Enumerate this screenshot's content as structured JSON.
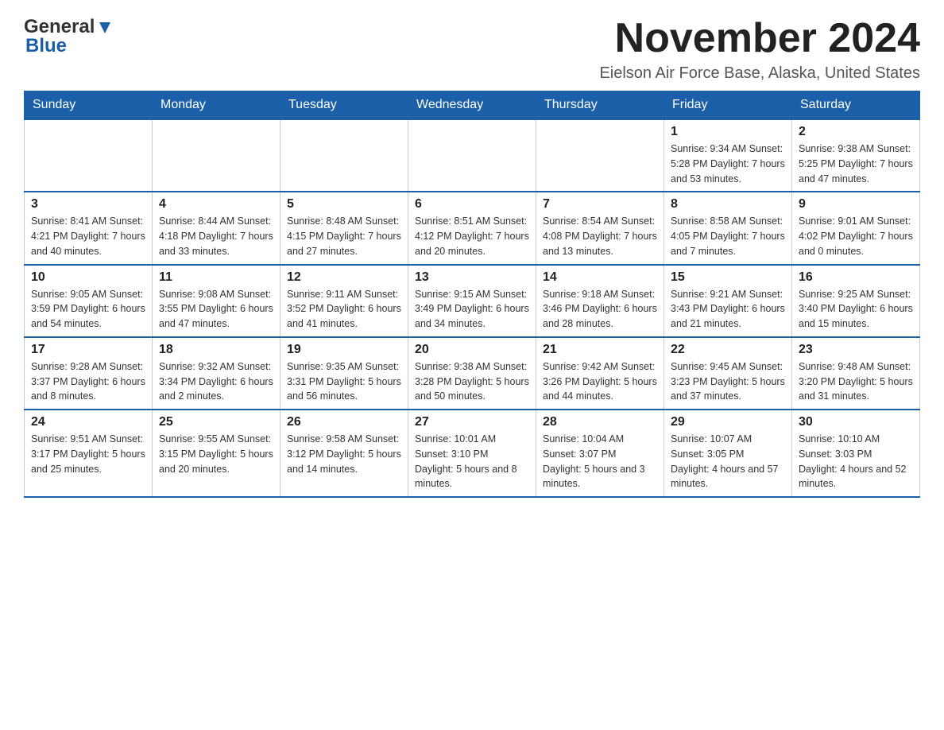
{
  "logo": {
    "general": "General",
    "blue": "Blue"
  },
  "title": "November 2024",
  "subtitle": "Eielson Air Force Base, Alaska, United States",
  "weekdays": [
    "Sunday",
    "Monday",
    "Tuesday",
    "Wednesday",
    "Thursday",
    "Friday",
    "Saturday"
  ],
  "weeks": [
    [
      {
        "day": "",
        "info": ""
      },
      {
        "day": "",
        "info": ""
      },
      {
        "day": "",
        "info": ""
      },
      {
        "day": "",
        "info": ""
      },
      {
        "day": "",
        "info": ""
      },
      {
        "day": "1",
        "info": "Sunrise: 9:34 AM\nSunset: 5:28 PM\nDaylight: 7 hours\nand 53 minutes."
      },
      {
        "day": "2",
        "info": "Sunrise: 9:38 AM\nSunset: 5:25 PM\nDaylight: 7 hours\nand 47 minutes."
      }
    ],
    [
      {
        "day": "3",
        "info": "Sunrise: 8:41 AM\nSunset: 4:21 PM\nDaylight: 7 hours\nand 40 minutes."
      },
      {
        "day": "4",
        "info": "Sunrise: 8:44 AM\nSunset: 4:18 PM\nDaylight: 7 hours\nand 33 minutes."
      },
      {
        "day": "5",
        "info": "Sunrise: 8:48 AM\nSunset: 4:15 PM\nDaylight: 7 hours\nand 27 minutes."
      },
      {
        "day": "6",
        "info": "Sunrise: 8:51 AM\nSunset: 4:12 PM\nDaylight: 7 hours\nand 20 minutes."
      },
      {
        "day": "7",
        "info": "Sunrise: 8:54 AM\nSunset: 4:08 PM\nDaylight: 7 hours\nand 13 minutes."
      },
      {
        "day": "8",
        "info": "Sunrise: 8:58 AM\nSunset: 4:05 PM\nDaylight: 7 hours\nand 7 minutes."
      },
      {
        "day": "9",
        "info": "Sunrise: 9:01 AM\nSunset: 4:02 PM\nDaylight: 7 hours\nand 0 minutes."
      }
    ],
    [
      {
        "day": "10",
        "info": "Sunrise: 9:05 AM\nSunset: 3:59 PM\nDaylight: 6 hours\nand 54 minutes."
      },
      {
        "day": "11",
        "info": "Sunrise: 9:08 AM\nSunset: 3:55 PM\nDaylight: 6 hours\nand 47 minutes."
      },
      {
        "day": "12",
        "info": "Sunrise: 9:11 AM\nSunset: 3:52 PM\nDaylight: 6 hours\nand 41 minutes."
      },
      {
        "day": "13",
        "info": "Sunrise: 9:15 AM\nSunset: 3:49 PM\nDaylight: 6 hours\nand 34 minutes."
      },
      {
        "day": "14",
        "info": "Sunrise: 9:18 AM\nSunset: 3:46 PM\nDaylight: 6 hours\nand 28 minutes."
      },
      {
        "day": "15",
        "info": "Sunrise: 9:21 AM\nSunset: 3:43 PM\nDaylight: 6 hours\nand 21 minutes."
      },
      {
        "day": "16",
        "info": "Sunrise: 9:25 AM\nSunset: 3:40 PM\nDaylight: 6 hours\nand 15 minutes."
      }
    ],
    [
      {
        "day": "17",
        "info": "Sunrise: 9:28 AM\nSunset: 3:37 PM\nDaylight: 6 hours\nand 8 minutes."
      },
      {
        "day": "18",
        "info": "Sunrise: 9:32 AM\nSunset: 3:34 PM\nDaylight: 6 hours\nand 2 minutes."
      },
      {
        "day": "19",
        "info": "Sunrise: 9:35 AM\nSunset: 3:31 PM\nDaylight: 5 hours\nand 56 minutes."
      },
      {
        "day": "20",
        "info": "Sunrise: 9:38 AM\nSunset: 3:28 PM\nDaylight: 5 hours\nand 50 minutes."
      },
      {
        "day": "21",
        "info": "Sunrise: 9:42 AM\nSunset: 3:26 PM\nDaylight: 5 hours\nand 44 minutes."
      },
      {
        "day": "22",
        "info": "Sunrise: 9:45 AM\nSunset: 3:23 PM\nDaylight: 5 hours\nand 37 minutes."
      },
      {
        "day": "23",
        "info": "Sunrise: 9:48 AM\nSunset: 3:20 PM\nDaylight: 5 hours\nand 31 minutes."
      }
    ],
    [
      {
        "day": "24",
        "info": "Sunrise: 9:51 AM\nSunset: 3:17 PM\nDaylight: 5 hours\nand 25 minutes."
      },
      {
        "day": "25",
        "info": "Sunrise: 9:55 AM\nSunset: 3:15 PM\nDaylight: 5 hours\nand 20 minutes."
      },
      {
        "day": "26",
        "info": "Sunrise: 9:58 AM\nSunset: 3:12 PM\nDaylight: 5 hours\nand 14 minutes."
      },
      {
        "day": "27",
        "info": "Sunrise: 10:01 AM\nSunset: 3:10 PM\nDaylight: 5 hours\nand 8 minutes."
      },
      {
        "day": "28",
        "info": "Sunrise: 10:04 AM\nSunset: 3:07 PM\nDaylight: 5 hours\nand 3 minutes."
      },
      {
        "day": "29",
        "info": "Sunrise: 10:07 AM\nSunset: 3:05 PM\nDaylight: 4 hours\nand 57 minutes."
      },
      {
        "day": "30",
        "info": "Sunrise: 10:10 AM\nSunset: 3:03 PM\nDaylight: 4 hours\nand 52 minutes."
      }
    ]
  ]
}
